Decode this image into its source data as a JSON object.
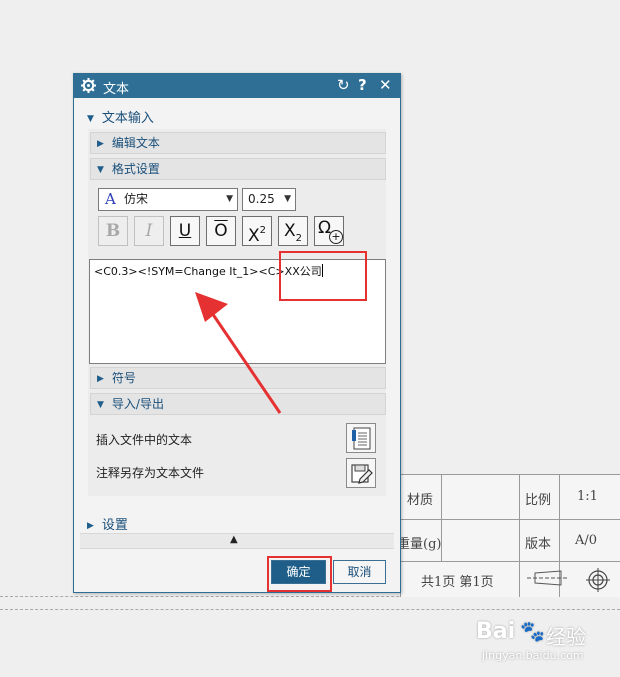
{
  "dialog": {
    "title": "文本",
    "reset_icon": "↻",
    "help_icon": "?",
    "close_icon": "✕",
    "sections": {
      "text_input": "文本输入",
      "edit_text": "编辑文本",
      "format": "格式设置",
      "symbol": "符号",
      "import_export": "导入/导出",
      "settings": "设置"
    },
    "font": {
      "icon": "A",
      "value": "仿宋"
    },
    "size": {
      "value": "0.25"
    },
    "format_buttons": {
      "bold": "B",
      "italic": "I",
      "underline": "U",
      "overline": "O",
      "superscript": "X",
      "superscript_mark": "2",
      "subscript": "X",
      "subscript_mark": "2",
      "symbol": "Ω",
      "symbol_plus": "+"
    },
    "text_content_code": "<C0.3><!SYM=Change It_1><C>",
    "text_content_company": "XX公司",
    "import_label": "插入文件中的文本",
    "export_label": "注释另存为文本文件",
    "expand_icon": "▲",
    "ok": "确定",
    "cancel": "取消"
  },
  "title_block": {
    "material": "材质",
    "scale_label": "比例",
    "scale_value": "1:1",
    "weight": "重量(g)",
    "version_label": "版本",
    "version_value": "A/0",
    "pages": "共1页 第1页"
  },
  "watermark": {
    "brand": "Bai",
    "paw": "🐾",
    "brand2": "经验",
    "url": "jingyan.baidu.com"
  },
  "colors": {
    "title_bar": "#2f6f95",
    "section_text": "#1a4f7a",
    "ok_button": "#1f5e88",
    "annotation": "#e53131"
  }
}
